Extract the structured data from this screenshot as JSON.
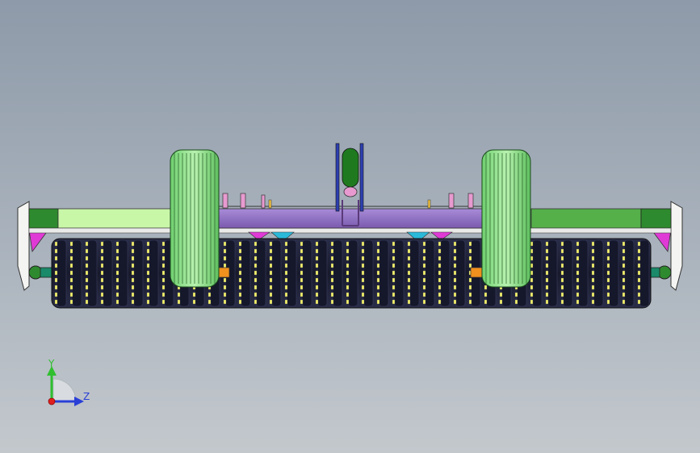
{
  "view": {
    "background_top": "#8e9aa9",
    "background_bottom": "#c3c8cd"
  },
  "model": {
    "colors": {
      "frame_light_green": "#c8f7a8",
      "frame_dark_green": "#2e8a2e",
      "frame_mid_green": "#55b04a",
      "beam_purple": "#8a6bbd",
      "wheel_green": "#9be39b",
      "roller_dark": "#20233a",
      "tooth_yellow": "#f2f06a",
      "magenta": "#e03ad6",
      "cyan": "#2bb9d9",
      "orange": "#f0901e",
      "mast_green": "#1f7a1f",
      "mast_blue": "#2d3fb0",
      "pink": "#e89ad0",
      "end_plate": "#f4f4f2"
    }
  },
  "triad": {
    "y_label": "Y",
    "z_label": "Z",
    "y_color": "#2fbf2f",
    "z_color": "#2a3fd6",
    "x_color": "#e02020"
  }
}
